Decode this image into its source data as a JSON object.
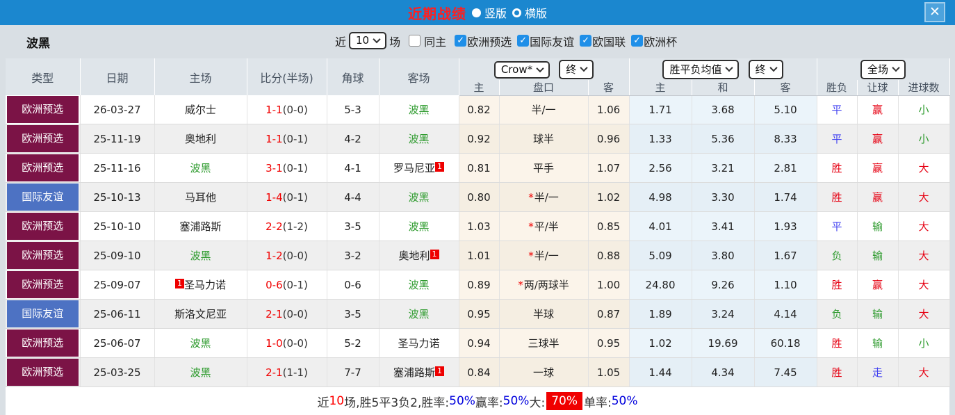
{
  "titlebar": {
    "title": "近期战绩",
    "radio_vertical": "竖版",
    "radio_horizontal": "横版",
    "close_label": "×"
  },
  "filters": {
    "team": "波黑",
    "recent_label": "近",
    "recent_value": "10",
    "games_label": "场",
    "same_home_label": "同主",
    "comp_checks": [
      {
        "label": "欧洲预选",
        "checked": true
      },
      {
        "label": "国际友谊",
        "checked": true
      },
      {
        "label": "欧国联",
        "checked": true
      },
      {
        "label": "欧洲杯",
        "checked": true
      }
    ]
  },
  "header": {
    "static_cols": [
      "类型",
      "日期",
      "主场",
      "比分(半场)",
      "角球",
      "客场"
    ],
    "ah_select": "Crow*",
    "ah_time_select": "终",
    "ah_subcols": [
      "主",
      "盘口",
      "客"
    ],
    "avg_select": "胜平负均值",
    "avg_time_select": "终",
    "avg_subcols": [
      "主",
      "和",
      "客"
    ],
    "scope_select": "全场",
    "result_subcols": [
      "胜负",
      "让球",
      "进球数"
    ]
  },
  "table": {
    "rows": [
      {
        "type": "欧洲预选",
        "type_color": "purple",
        "date": "26-03-27",
        "home": {
          "name": "威尔士",
          "green": false,
          "badge": "",
          "badge_pos": ""
        },
        "score": "1-1",
        "half": "(0-0)",
        "corner": "5-3",
        "away": {
          "name": "波黑",
          "green": true,
          "badge": "",
          "badge_pos": ""
        },
        "ah": {
          "home": "0.82",
          "star": false,
          "line": "半/一",
          "away": "1.06"
        },
        "avg": {
          "win": "1.71",
          "draw": "3.68",
          "lose": "5.10"
        },
        "res": {
          "wdl": "平",
          "wdl_c": "b",
          "let": "赢",
          "let_c": "r",
          "size": "小",
          "size_c": "g"
        }
      },
      {
        "type": "欧洲预选",
        "type_color": "purple",
        "date": "25-11-19",
        "home": {
          "name": "奥地利",
          "green": false,
          "badge": "",
          "badge_pos": ""
        },
        "score": "1-1",
        "half": "(0-1)",
        "corner": "4-2",
        "away": {
          "name": "波黑",
          "green": true,
          "badge": "",
          "badge_pos": ""
        },
        "ah": {
          "home": "0.92",
          "star": false,
          "line": "球半",
          "away": "0.96"
        },
        "avg": {
          "win": "1.33",
          "draw": "5.36",
          "lose": "8.33"
        },
        "res": {
          "wdl": "平",
          "wdl_c": "b",
          "let": "赢",
          "let_c": "r",
          "size": "小",
          "size_c": "g"
        }
      },
      {
        "type": "欧洲预选",
        "type_color": "purple",
        "date": "25-11-16",
        "home": {
          "name": "波黑",
          "green": true,
          "badge": "",
          "badge_pos": ""
        },
        "score": "3-1",
        "half": "(0-1)",
        "corner": "4-1",
        "away": {
          "name": "罗马尼亚",
          "green": false,
          "badge": "1",
          "badge_pos": "post"
        },
        "ah": {
          "home": "0.81",
          "star": false,
          "line": "平手",
          "away": "1.07"
        },
        "avg": {
          "win": "2.56",
          "draw": "3.21",
          "lose": "2.81"
        },
        "res": {
          "wdl": "胜",
          "wdl_c": "r",
          "let": "赢",
          "let_c": "r",
          "size": "大",
          "size_c": "r"
        }
      },
      {
        "type": "国际友谊",
        "type_color": "blue",
        "date": "25-10-13",
        "home": {
          "name": "马耳他",
          "green": false,
          "badge": "",
          "badge_pos": ""
        },
        "score": "1-4",
        "half": "(0-1)",
        "corner": "4-4",
        "away": {
          "name": "波黑",
          "green": true,
          "badge": "",
          "badge_pos": ""
        },
        "ah": {
          "home": "0.80",
          "star": true,
          "line": "半/一",
          "away": "1.02"
        },
        "avg": {
          "win": "4.98",
          "draw": "3.30",
          "lose": "1.74"
        },
        "res": {
          "wdl": "胜",
          "wdl_c": "r",
          "let": "赢",
          "let_c": "r",
          "size": "大",
          "size_c": "r"
        }
      },
      {
        "type": "欧洲预选",
        "type_color": "purple",
        "date": "25-10-10",
        "home": {
          "name": "塞浦路斯",
          "green": false,
          "badge": "",
          "badge_pos": ""
        },
        "score": "2-2",
        "half": "(1-2)",
        "corner": "3-5",
        "away": {
          "name": "波黑",
          "green": true,
          "badge": "",
          "badge_pos": ""
        },
        "ah": {
          "home": "1.03",
          "star": true,
          "line": "平/半",
          "away": "0.85"
        },
        "avg": {
          "win": "4.01",
          "draw": "3.41",
          "lose": "1.93"
        },
        "res": {
          "wdl": "平",
          "wdl_c": "b",
          "let": "输",
          "let_c": "g",
          "size": "大",
          "size_c": "r"
        }
      },
      {
        "type": "欧洲预选",
        "type_color": "purple",
        "date": "25-09-10",
        "home": {
          "name": "波黑",
          "green": true,
          "badge": "",
          "badge_pos": ""
        },
        "score": "1-2",
        "half": "(0-0)",
        "corner": "3-2",
        "away": {
          "name": "奥地利",
          "green": false,
          "badge": "1",
          "badge_pos": "post"
        },
        "ah": {
          "home": "1.01",
          "star": true,
          "line": "半/一",
          "away": "0.88"
        },
        "avg": {
          "win": "5.09",
          "draw": "3.80",
          "lose": "1.67"
        },
        "res": {
          "wdl": "负",
          "wdl_c": "g",
          "let": "输",
          "let_c": "g",
          "size": "大",
          "size_c": "r"
        }
      },
      {
        "type": "欧洲预选",
        "type_color": "purple",
        "date": "25-09-07",
        "home": {
          "name": "圣马力诺",
          "green": false,
          "badge": "1",
          "badge_pos": "pre"
        },
        "score": "0-6",
        "half": "(0-1)",
        "corner": "0-6",
        "away": {
          "name": "波黑",
          "green": true,
          "badge": "",
          "badge_pos": ""
        },
        "ah": {
          "home": "0.89",
          "star": true,
          "line": "两/两球半",
          "away": "1.00"
        },
        "avg": {
          "win": "24.80",
          "draw": "9.26",
          "lose": "1.10"
        },
        "res": {
          "wdl": "胜",
          "wdl_c": "r",
          "let": "赢",
          "let_c": "r",
          "size": "大",
          "size_c": "r"
        }
      },
      {
        "type": "国际友谊",
        "type_color": "blue",
        "date": "25-06-11",
        "home": {
          "name": "斯洛文尼亚",
          "green": false,
          "badge": "",
          "badge_pos": ""
        },
        "score": "2-1",
        "half": "(0-0)",
        "corner": "3-5",
        "away": {
          "name": "波黑",
          "green": true,
          "badge": "",
          "badge_pos": ""
        },
        "ah": {
          "home": "0.95",
          "star": false,
          "line": "半球",
          "away": "0.87"
        },
        "avg": {
          "win": "1.89",
          "draw": "3.24",
          "lose": "4.14"
        },
        "res": {
          "wdl": "负",
          "wdl_c": "g",
          "let": "输",
          "let_c": "g",
          "size": "大",
          "size_c": "r"
        }
      },
      {
        "type": "欧洲预选",
        "type_color": "purple",
        "date": "25-06-07",
        "home": {
          "name": "波黑",
          "green": true,
          "badge": "",
          "badge_pos": ""
        },
        "score": "1-0",
        "half": "(0-0)",
        "corner": "5-2",
        "away": {
          "name": "圣马力诺",
          "green": false,
          "badge": "",
          "badge_pos": ""
        },
        "ah": {
          "home": "0.94",
          "star": false,
          "line": "三球半",
          "away": "0.95"
        },
        "avg": {
          "win": "1.02",
          "draw": "19.69",
          "lose": "60.18"
        },
        "res": {
          "wdl": "胜",
          "wdl_c": "r",
          "let": "输",
          "let_c": "g",
          "size": "小",
          "size_c": "g"
        }
      },
      {
        "type": "欧洲预选",
        "type_color": "purple",
        "date": "25-03-25",
        "home": {
          "name": "波黑",
          "green": true,
          "badge": "",
          "badge_pos": ""
        },
        "score": "2-1",
        "half": "(1-1)",
        "corner": "7-7",
        "away": {
          "name": "塞浦路斯",
          "green": false,
          "badge": "1",
          "badge_pos": "post"
        },
        "ah": {
          "home": "0.84",
          "star": false,
          "line": "一球",
          "away": "1.05"
        },
        "avg": {
          "win": "1.44",
          "draw": "4.34",
          "lose": "7.45"
        },
        "res": {
          "wdl": "胜",
          "wdl_c": "r",
          "let": "走",
          "let_c": "b",
          "size": "大",
          "size_c": "r"
        }
      }
    ]
  },
  "summary": {
    "segments": [
      {
        "text": "近",
        "style": "k"
      },
      {
        "text": "10",
        "style": "r"
      },
      {
        "text": "场,胜5平3负2, ",
        "style": "k"
      },
      {
        "text": "胜率:",
        "style": "k"
      },
      {
        "text": "50%",
        "style": "b"
      },
      {
        "text": " 赢率:",
        "style": "k"
      },
      {
        "text": "50%",
        "style": "b"
      },
      {
        "text": " 大:",
        "style": "k"
      },
      {
        "text": "70%",
        "style": "hl"
      },
      {
        "text": " 单率:",
        "style": "k"
      },
      {
        "text": "50%",
        "style": "b"
      }
    ]
  },
  "colors": {
    "topbar": "#1b87cf",
    "title_red": "#ff1f1f",
    "type_purple": "#7b1346",
    "type_blue": "#4d72c3",
    "team_green": "#2e9b2e",
    "score_red": "#f00000",
    "result_red": "#e60012",
    "result_blue": "#4343f0",
    "result_green": "#2e9b2e",
    "checkbox_blue": "#1f8fe8",
    "odds_cream_bg": "#fbf4ea",
    "odds_blue_bg": "#ebf4fa"
  }
}
